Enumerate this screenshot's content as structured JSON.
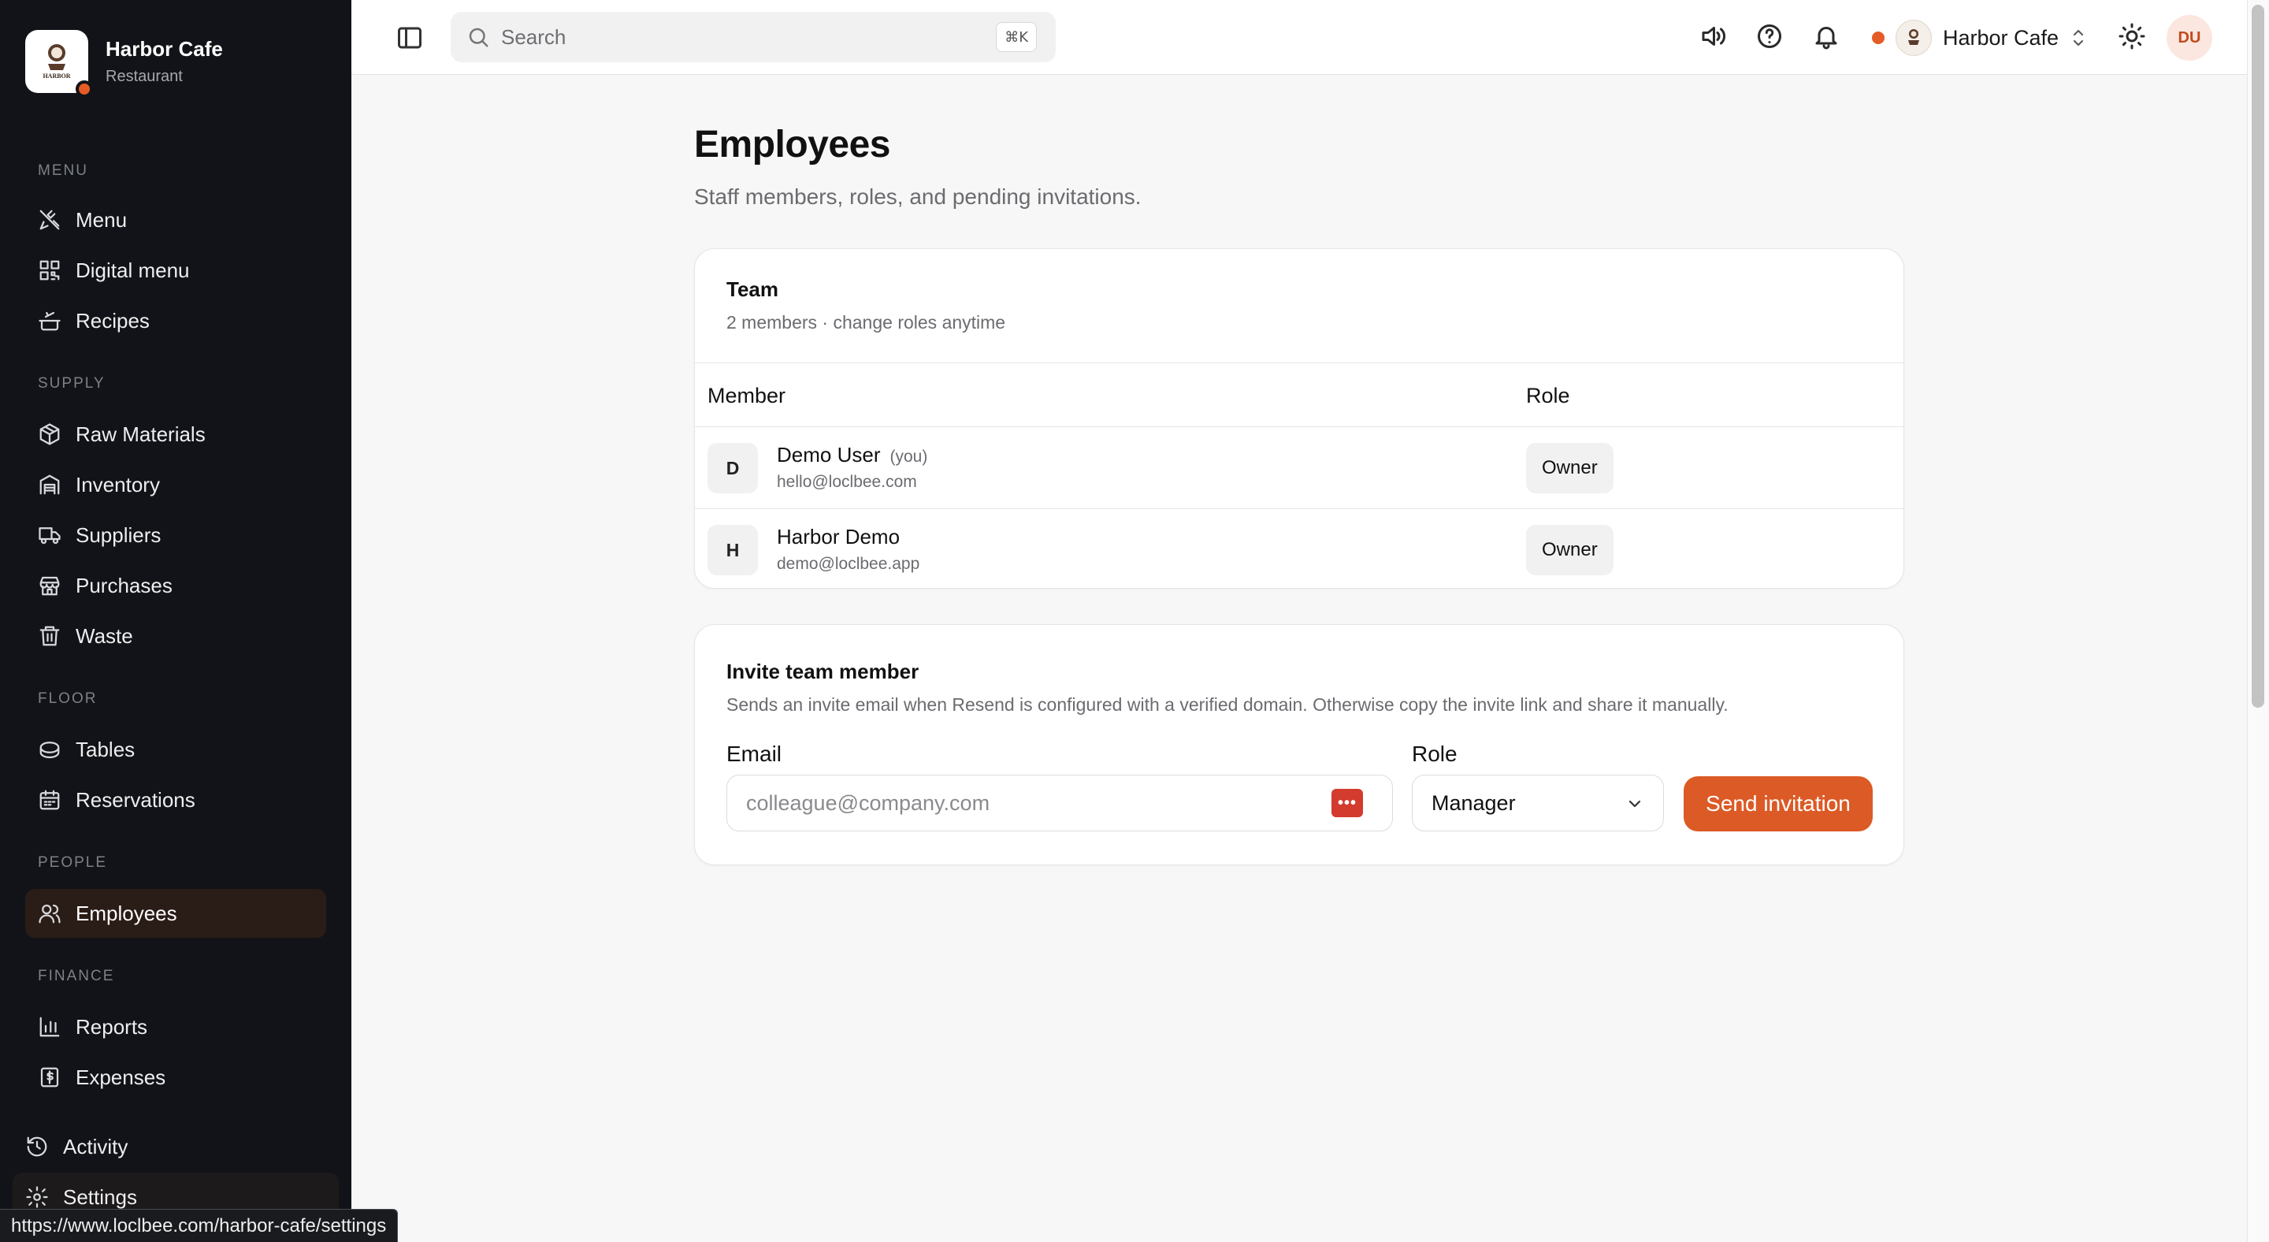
{
  "brand": {
    "name": "Harbor Cafe",
    "subtitle": "Restaurant",
    "logo_text": "HARBOR"
  },
  "sidebar": {
    "sections": [
      {
        "title": "Menu",
        "items": [
          {
            "label": "Menu",
            "icon": "utensils-icon"
          },
          {
            "label": "Digital menu",
            "icon": "qr-code-icon"
          },
          {
            "label": "Recipes",
            "icon": "cooking-pot-icon"
          }
        ]
      },
      {
        "title": "Supply",
        "items": [
          {
            "label": "Raw Materials",
            "icon": "package-icon"
          },
          {
            "label": "Inventory",
            "icon": "warehouse-icon"
          },
          {
            "label": "Suppliers",
            "icon": "truck-icon"
          },
          {
            "label": "Purchases",
            "icon": "store-icon"
          },
          {
            "label": "Waste",
            "icon": "trash-icon"
          }
        ]
      },
      {
        "title": "Floor",
        "items": [
          {
            "label": "Tables",
            "icon": "table-icon"
          },
          {
            "label": "Reservations",
            "icon": "calendar-icon"
          }
        ]
      },
      {
        "title": "People",
        "items": [
          {
            "label": "Employees",
            "icon": "users-icon",
            "active": true
          }
        ]
      },
      {
        "title": "Finance",
        "items": [
          {
            "label": "Reports",
            "icon": "bar-chart-icon"
          },
          {
            "label": "Expenses",
            "icon": "receipt-icon"
          }
        ]
      }
    ],
    "bottom": [
      {
        "label": "Activity",
        "icon": "history-icon"
      },
      {
        "label": "Settings",
        "icon": "gear-icon"
      }
    ]
  },
  "status_url": "https://www.loclbee.com/harbor-cafe/settings",
  "topbar": {
    "search_placeholder": "Search",
    "search_shortcut": "⌘K",
    "workspace_name": "Harbor Cafe",
    "avatar_initials": "DU"
  },
  "page": {
    "title": "Employees",
    "subtitle": "Staff members, roles, and pending invitations."
  },
  "team": {
    "title": "Team",
    "description": "2 members · change roles anytime",
    "columns": [
      "Member",
      "Role"
    ],
    "members": [
      {
        "initial": "D",
        "name": "Demo User",
        "you_tag": "(you)",
        "email": "hello@loclbee.com",
        "role": "Owner"
      },
      {
        "initial": "H",
        "name": "Harbor Demo",
        "you_tag": "",
        "email": "demo@loclbee.app",
        "role": "Owner"
      }
    ]
  },
  "invite": {
    "title": "Invite team member",
    "description": "Sends an invite email when Resend is configured with a verified domain. Otherwise copy the invite link and share it manually.",
    "email_label": "Email",
    "email_value": "",
    "email_placeholder": "colleague@company.com",
    "role_label": "Role",
    "role_value": "Manager",
    "submit_label": "Send invitation"
  },
  "colors": {
    "accent": "#dc5a25",
    "sidebar_bg": "#111318",
    "active_bg": "#2a1c16"
  }
}
